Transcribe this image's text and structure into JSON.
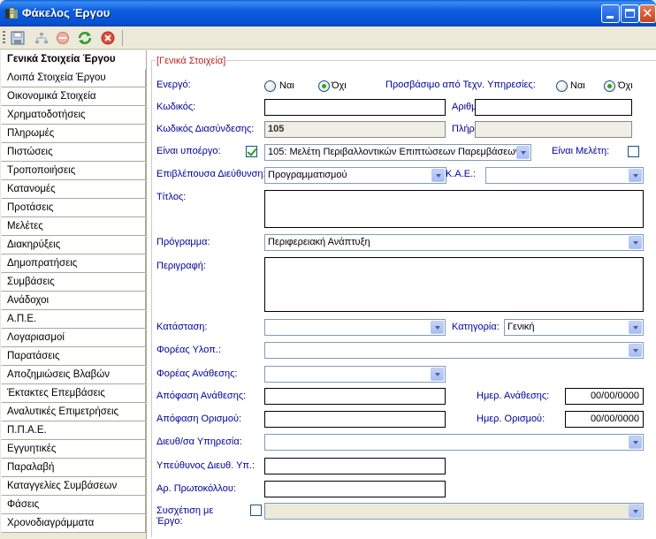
{
  "window": {
    "title": "Φάκελος Έργου",
    "title_bar_color": "#0a5ee0"
  },
  "toolbar": {
    "buttons": [
      {
        "icon": "save-icon"
      },
      {
        "icon": "tree-icon"
      },
      {
        "icon": "delete-icon"
      },
      {
        "icon": "refresh-icon"
      },
      {
        "icon": "cancel-icon"
      }
    ]
  },
  "nav": {
    "items": [
      {
        "label": "Γενικά Στοιχεία Έργου",
        "active": true
      },
      {
        "label": "Λοιπά Στοιχεία Έργου"
      },
      {
        "label": "Οικονομικά Στοιχεία"
      },
      {
        "label": "Χρηματοδοτήσεις"
      },
      {
        "label": "Πληρωμές"
      },
      {
        "label": "Πιστώσεις"
      },
      {
        "label": "Τροποποιήσεις"
      },
      {
        "label": "Κατανομές"
      },
      {
        "label": "Προτάσεις"
      },
      {
        "label": "Μελέτες"
      },
      {
        "label": "Διακηρύξεις"
      },
      {
        "label": "Δημοπρατήσεις"
      },
      {
        "label": "Συμβάσεις"
      },
      {
        "label": "Ανάδοχοι"
      },
      {
        "label": "Α.Π.Ε."
      },
      {
        "label": "Λογαριασμοί"
      },
      {
        "label": "Παρατάσεις"
      },
      {
        "label": "Αποζημιώσεις Βλαβών"
      },
      {
        "label": "Έκτακτες Επεμβάσεις"
      },
      {
        "label": "Αναλυτικές Επιμετρήσεις"
      },
      {
        "label": "Π.Π.Α.Ε."
      },
      {
        "label": "Εγγυητικές"
      },
      {
        "label": "Παραλαβή"
      },
      {
        "label": "Καταγγελίες Συμβάσεων"
      },
      {
        "label": "Φάσεις"
      },
      {
        "label": "Χρονοδιαγράμματα"
      }
    ]
  },
  "form": {
    "group_title": "[Γενικά Στοιχεία]",
    "active": {
      "label": "Ενεργό:",
      "yes": "Ναι",
      "no": "Όχι",
      "selected": "no"
    },
    "accessible": {
      "label": "Προσβάσιμο από Τεχν. Υπηρεσίες:",
      "yes": "Ναι",
      "no": "Όχι",
      "selected": "no"
    },
    "code": {
      "label": "Κωδικός:",
      "value": ""
    },
    "folder_no": {
      "label": "Αριθμός Φακέλου:",
      "value": ""
    },
    "link_code": {
      "label": "Κωδικός Διασύνδεσης:",
      "value": "105"
    },
    "full_code": {
      "label": "Πλήρης κωδικός:",
      "value": ""
    },
    "is_subproject": {
      "label": "Είναι υποέργο:",
      "checked": true,
      "value": "105: Μελέτη Περιβαλλοντικών Επιπτώσεων Παρεμβάσεων"
    },
    "is_study": {
      "label": "Είναι Μελέτη:",
      "checked": false
    },
    "supervising": {
      "label": "Επιβλέπουσα Διεύθυνση:",
      "value": "Προγραμματισμού"
    },
    "kae": {
      "label": "Κ.Α.Ε.:",
      "value": ""
    },
    "title": {
      "label": "Τίτλος:",
      "value": ""
    },
    "program": {
      "label": "Πρόγραμμα:",
      "value": "Περιφερειακή Ανάπτυξη"
    },
    "description": {
      "label": "Περιγραφή:",
      "value": ""
    },
    "status": {
      "label": "Κατάσταση:",
      "value": ""
    },
    "category": {
      "label": "Κατηγορία:",
      "value": "Γενική"
    },
    "implementing": {
      "label": "Φορέας Υλοπ.:",
      "value": ""
    },
    "assigning": {
      "label": "Φορέας Ανάθεσης:",
      "value": ""
    },
    "assign_decision": {
      "label": "Απόφαση Ανάθεσης:",
      "value": ""
    },
    "assign_date": {
      "label": "Ημερ. Ανάθεσης:",
      "value": "00/00/0000"
    },
    "define_decision": {
      "label": "Απόφαση Ορισμού:",
      "value": ""
    },
    "define_date": {
      "label": "Ημερ. Ορισμού:",
      "value": "00/00/0000"
    },
    "directorate": {
      "label": "Διευθ/σα Υπηρεσία:",
      "value": ""
    },
    "responsible": {
      "label": "Υπεύθυνος Διευθ. Υπ.:",
      "value": ""
    },
    "protocol": {
      "label": "Αρ. Πρωτοκόλλου:",
      "value": ""
    },
    "related": {
      "label_line1": "Συσχέτιση με",
      "label_line2": "Έργο:",
      "checked": false,
      "value": ""
    }
  }
}
